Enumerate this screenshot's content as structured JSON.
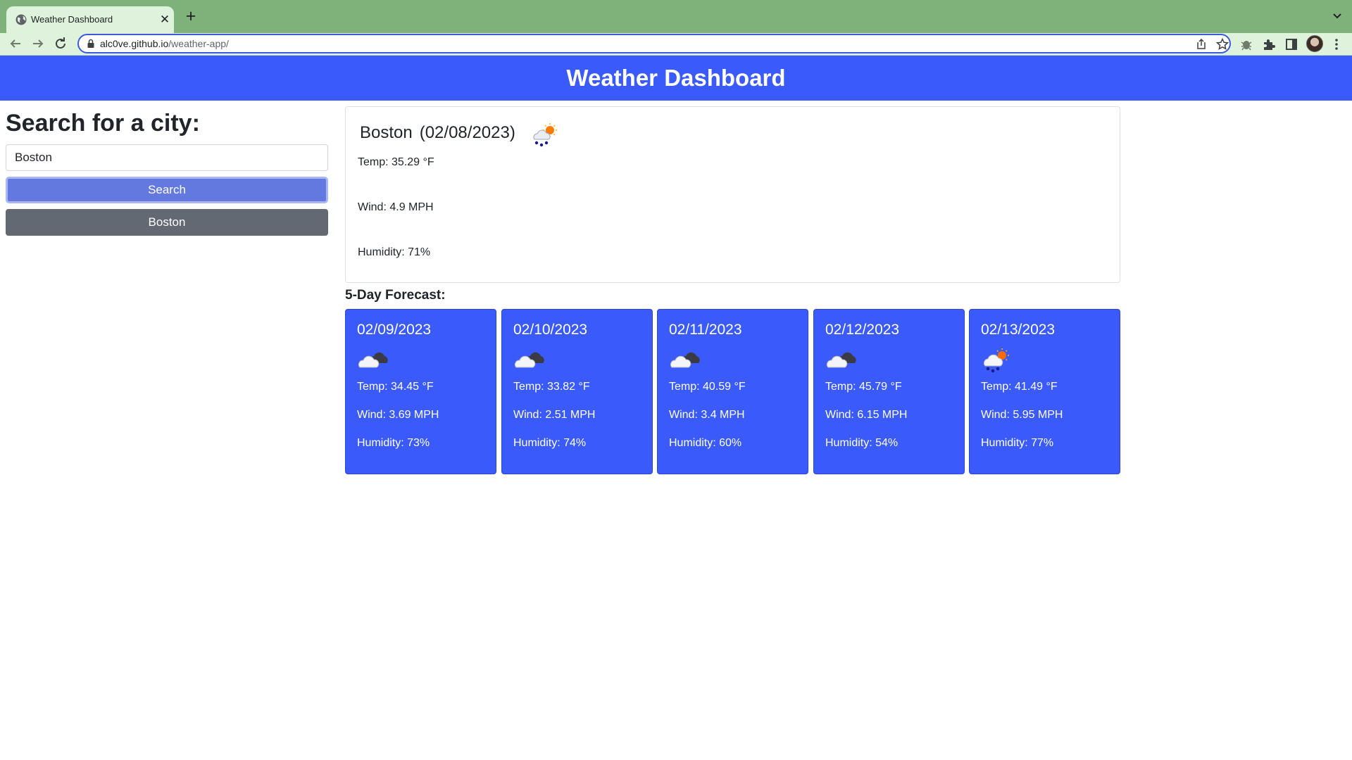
{
  "browser": {
    "tab_title": "Weather Dashboard",
    "url_domain": "alc0ve.github.io",
    "url_path": "/weather-app/"
  },
  "app": {
    "title": "Weather Dashboard"
  },
  "search": {
    "heading": "Search for a city:",
    "input_value": "Boston",
    "button_label": "Search",
    "history": [
      "Boston"
    ]
  },
  "current": {
    "city": "Boston",
    "date": "(02/08/2023)",
    "icon": "rain-sun-icon",
    "temp": "Temp: 35.29 °F",
    "wind": "Wind: 4.9 MPH",
    "humidity": "Humidity: 71%"
  },
  "forecast": {
    "heading": "5-Day Forecast:",
    "days": [
      {
        "date": "02/09/2023",
        "icon": "cloudy-icon",
        "temp": "Temp: 34.45 °F",
        "wind": "Wind: 3.69 MPH",
        "humidity": "Humidity: 73%"
      },
      {
        "date": "02/10/2023",
        "icon": "cloudy-icon",
        "temp": "Temp: 33.82 °F",
        "wind": "Wind: 2.51 MPH",
        "humidity": "Humidity: 74%"
      },
      {
        "date": "02/11/2023",
        "icon": "cloudy-icon",
        "temp": "Temp: 40.59 °F",
        "wind": "Wind: 3.4 MPH",
        "humidity": "Humidity: 60%"
      },
      {
        "date": "02/12/2023",
        "icon": "cloudy-icon",
        "temp": "Temp: 45.79 °F",
        "wind": "Wind: 6.15 MPH",
        "humidity": "Humidity: 54%"
      },
      {
        "date": "02/13/2023",
        "icon": "rain-sun-icon",
        "temp": "Temp: 41.49 °F",
        "wind": "Wind: 5.95 MPH",
        "humidity": "Humidity: 77%"
      }
    ]
  },
  "colors": {
    "header_blue": "#3a5af9",
    "search_button": "#6479e0",
    "history_button": "#626973",
    "tabstrip_green": "#7fb27a"
  }
}
